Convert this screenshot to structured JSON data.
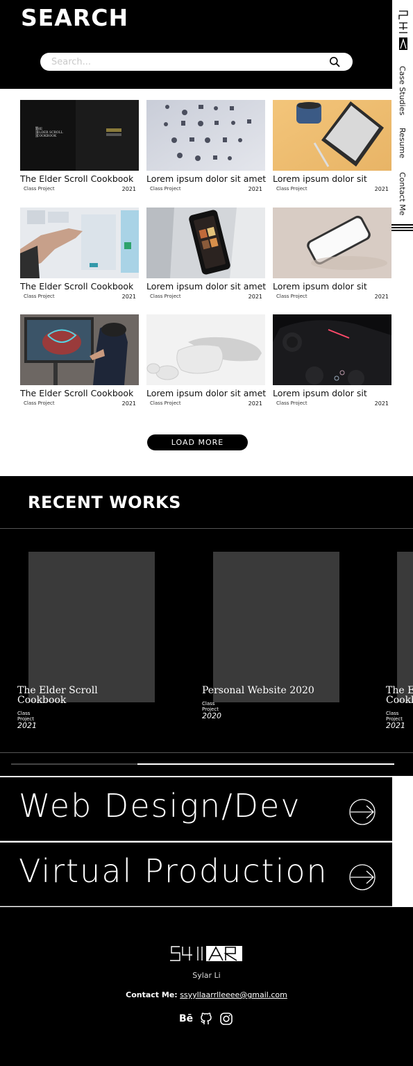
{
  "header": {
    "title": "SEARCH",
    "search_placeholder": "Search...",
    "search_icon": "search-icon"
  },
  "sidenav": {
    "logo_icon": "541ar-logo",
    "links": [
      "Case Studies",
      "Resume",
      "Contact Me"
    ]
  },
  "grid": [
    {
      "title": "The Elder Scroll Cookbook",
      "sub": "Class Project",
      "year": "2021",
      "thumb_text": "The Elder Scroll Cookbook"
    },
    {
      "title": "Lorem ipsum dolor sit amet",
      "sub": "Class Project",
      "year": "2021"
    },
    {
      "title": "Lorem ipsum dolor sit",
      "sub": "Class Project",
      "year": "2021"
    },
    {
      "title": "The Elder Scroll Cookbook",
      "sub": "Class Project",
      "year": "2021"
    },
    {
      "title": "Lorem ipsum dolor sit amet",
      "sub": "Class Project",
      "year": "2021"
    },
    {
      "title": "Lorem ipsum dolor sit",
      "sub": "Class Project",
      "year": "2021"
    },
    {
      "title": "The Elder Scroll Cookbook",
      "sub": "Class Project",
      "year": "2021"
    },
    {
      "title": "Lorem ipsum dolor sit amet",
      "sub": "Class Project",
      "year": "2021"
    },
    {
      "title": "Lorem ipsum dolor sit",
      "sub": "Class Project",
      "year": "2021"
    }
  ],
  "load_more": "LOAD MORE",
  "recent": {
    "title": "RECENT WORKS",
    "items": [
      {
        "title_line1": "The Elder Scroll",
        "title_line2": "Cookbook",
        "sub": "Class Project",
        "year": "2021"
      },
      {
        "title_line1": "Personal Website 2020",
        "title_line2": "",
        "sub": "Class Project",
        "year": "2020"
      },
      {
        "title_line1": "The Elder Scroll",
        "title_line2": "Cookbook",
        "sub": "Class Project",
        "year": "2021"
      }
    ],
    "slider_progress": 0.33
  },
  "categories": [
    "Web Design/Dev",
    "Virtual Production"
  ],
  "footer": {
    "logo_icon": "541ar-logo",
    "name": "Sylar Li",
    "contact_label": "Contact Me:",
    "email": "ssyyllaarrlleeee@gmail.com",
    "social_icons": [
      "behance-icon",
      "github-icon",
      "instagram-icon"
    ],
    "behance_text": "Bē"
  },
  "colors": {
    "background": "#000000",
    "surface": "#ffffff",
    "placeholder_box": "#3a3a3a"
  }
}
